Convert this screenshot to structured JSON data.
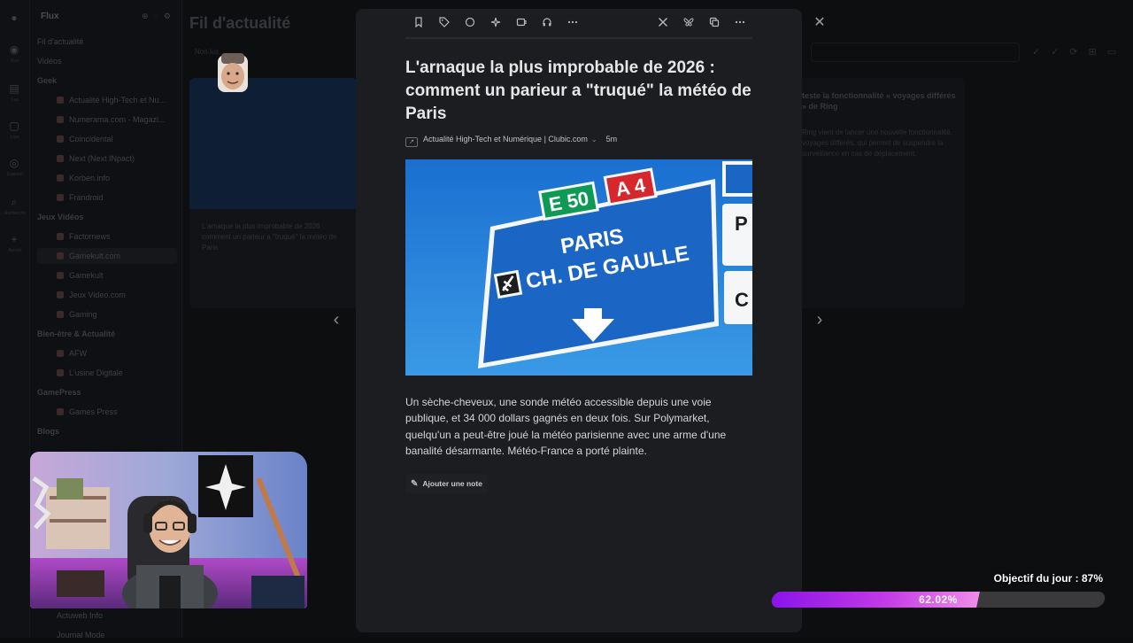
{
  "app": {
    "sidebar_title": "Flux",
    "rail_items": [
      "Flux",
      "Lus",
      "Liste",
      "Explorer",
      "Recherche",
      "Ajouter"
    ]
  },
  "sidebar": {
    "items": [
      {
        "label": "Fil d'actualité",
        "type": "item"
      },
      {
        "label": "Vidéos",
        "type": "item"
      },
      {
        "label": "Geek",
        "type": "section"
      },
      {
        "label": "Actualité High-Tech et Nu...",
        "type": "sub"
      },
      {
        "label": "Numerama.com - Magazi...",
        "type": "sub"
      },
      {
        "label": "Coincidental",
        "type": "sub"
      },
      {
        "label": "Next (Next INpact)",
        "type": "sub"
      },
      {
        "label": "Korben.info",
        "type": "sub"
      },
      {
        "label": "Frandroid",
        "type": "sub"
      },
      {
        "label": "Jeux Vidéos",
        "type": "section"
      },
      {
        "label": "Factornews",
        "type": "sub"
      },
      {
        "label": "Gamekult.com",
        "type": "sub"
      },
      {
        "label": "Gamekult",
        "type": "sub"
      },
      {
        "label": "Jeux Video.com",
        "type": "sub"
      },
      {
        "label": "Gaming",
        "type": "sub"
      },
      {
        "label": "Bien-être & Actualité",
        "type": "section"
      },
      {
        "label": "AFW",
        "type": "sub"
      },
      {
        "label": "L'usine Digitale",
        "type": "sub"
      },
      {
        "label": "GamePress",
        "type": "section"
      },
      {
        "label": "Games Press",
        "type": "sub"
      },
      {
        "label": "Blogs",
        "type": "section"
      }
    ],
    "bottom_items": [
      "Actuweb Info",
      "Journal Mode"
    ]
  },
  "main": {
    "title": "Fil d'actualité",
    "filter_label": "Non lus",
    "left_card_text": "L'arnaque la plus improbable de 2026 : comment un parieur a \"truqué\" la météo de Paris",
    "left_card_source": "Actualité High-Tech et Numérique | Clubic.com",
    "left_card_time": "5m",
    "right_card_title": "teste la fonctionnalité « voyages différés » de Ring",
    "right_card_text": "Ring vient de lancer une nouvelle fonctionnalité, voyages différés, qui permet de suspendre la surveillance en cas de déplacement."
  },
  "toolbar": {
    "left_icons": [
      "bookmark-icon",
      "tag-icon",
      "circle-icon",
      "sparkle-icon",
      "share-icon",
      "headphones-icon",
      "more-icon"
    ],
    "right_icons": [
      "x-icon",
      "bluesky-icon",
      "copy-icon",
      "more-icon"
    ]
  },
  "article": {
    "title": "L'arnaque la plus improbable de 2026 : comment un parieur a \"truqué\" la météo de Paris",
    "source": "Actualité High-Tech et Numérique | Clubic.com",
    "time": "5m",
    "sign_e50": "E 50",
    "sign_a4": "A 4",
    "sign_line1": "PARIS",
    "sign_line2": "CH. DE GAULLE",
    "body": "Un sèche-cheveux, une sonde météo accessible depuis une voie publique, et 34 000 dollars gagnés en deux fois. Sur Polymarket, quelqu'un a peut-être joué la météo parisienne avec une arme d'une banalité désarmante. Météo-France a porté plainte.",
    "note_button": "Ajouter une note"
  },
  "goal": {
    "label": "Objectif du jour : 87%",
    "percent_text": "62.02%",
    "progress": 0.6202,
    "fill_color": "#c33ae6"
  },
  "colors": {
    "background": "#0b0c0e",
    "modal": "#1c1d20",
    "sign_blue": "#1c80d6",
    "sign_green": "#0e9a55",
    "sign_red": "#d6282c"
  }
}
